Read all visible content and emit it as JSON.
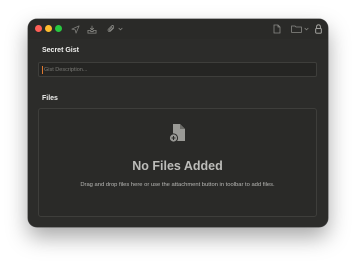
{
  "toolbar": {
    "icons": [
      "send-icon",
      "inbox-tray-icon",
      "paperclip-icon",
      "chevron-down-icon",
      "document-icon",
      "folder-icon",
      "lock-icon"
    ]
  },
  "gist": {
    "section_label": "Secret Gist",
    "description_placeholder": "Gist Description...",
    "description_value": ""
  },
  "files": {
    "section_label": "Files",
    "empty_title": "No Files Added",
    "empty_description": "Drag and drop files here or use the attachment button in toolbar to add files."
  },
  "colors": {
    "window_bg": "#2c2c2a",
    "close": "#ff5f57",
    "minimize": "#febc2e",
    "zoom": "#28c840",
    "caret": "#e0782f"
  }
}
